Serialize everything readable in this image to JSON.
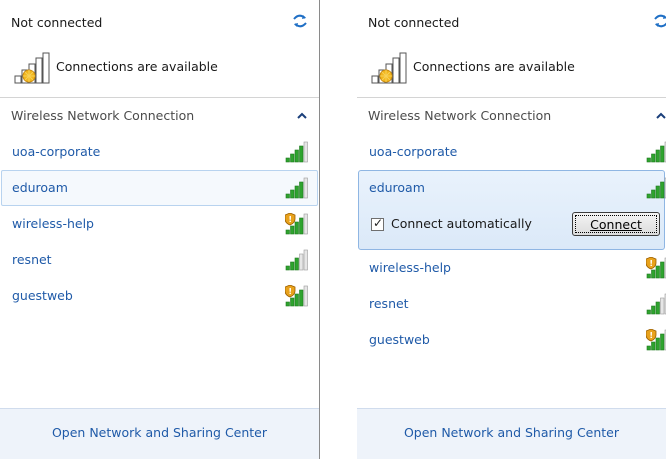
{
  "status": {
    "title": "Not connected",
    "availability": "Connections are available"
  },
  "section": {
    "header": "Wireless Network Connection"
  },
  "networks": [
    {
      "name": "uoa-corporate",
      "secured": true,
      "signal_bars": 4
    },
    {
      "name": "eduroam",
      "secured": true,
      "signal_bars": 4
    },
    {
      "name": "wireless-help",
      "secured": false,
      "signal_bars": 4
    },
    {
      "name": "resnet",
      "secured": true,
      "signal_bars": 3
    },
    {
      "name": "guestweb",
      "secured": false,
      "signal_bars": 4
    }
  ],
  "expanded": {
    "network": "eduroam",
    "auto_connect_label": "Connect automatically",
    "auto_connect_checked": true,
    "connect_label": "Connect"
  },
  "footer": {
    "link": "Open Network and Sharing Center"
  },
  "colors": {
    "link": "#1f5aa8",
    "selection_border": "#8fb6e3",
    "footer_bg": "#eef3fa",
    "signal_green": "#2ea32e",
    "warning_orange": "#e8a21c"
  }
}
